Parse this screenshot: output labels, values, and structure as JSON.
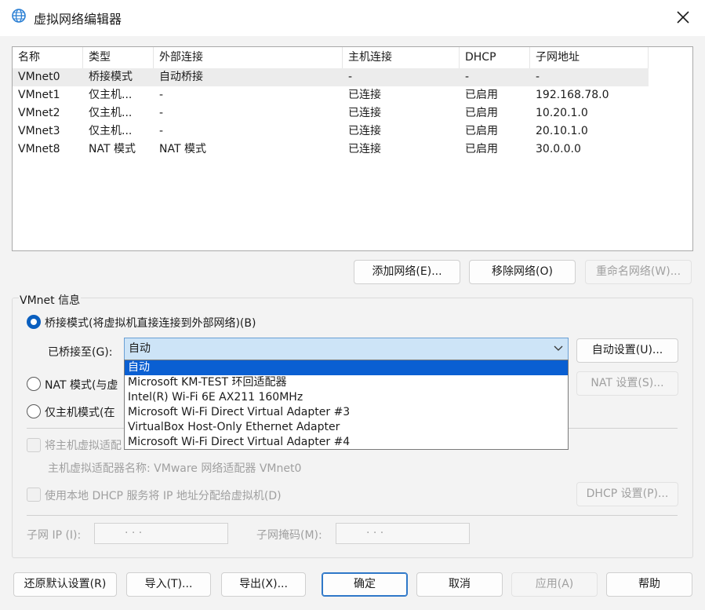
{
  "window": {
    "title": "虚拟网络编辑器",
    "icon": "network-globe-icon",
    "close_icon": "close-icon"
  },
  "table": {
    "headers": [
      "名称",
      "类型",
      "外部连接",
      "主机连接",
      "DHCP",
      "子网地址"
    ],
    "rows": [
      [
        "VMnet0",
        "桥接模式",
        "自动桥接",
        "-",
        "-",
        "-"
      ],
      [
        "VMnet1",
        "仅主机...",
        "-",
        "已连接",
        "已启用",
        "192.168.78.0"
      ],
      [
        "VMnet2",
        "仅主机...",
        "-",
        "已连接",
        "已启用",
        "10.20.1.0"
      ],
      [
        "VMnet3",
        "仅主机...",
        "-",
        "已连接",
        "已启用",
        "20.10.1.0"
      ],
      [
        "VMnet8",
        "NAT 模式",
        "NAT 模式",
        "已连接",
        "已启用",
        "30.0.0.0"
      ]
    ]
  },
  "table_buttons": {
    "add": "添加网络(E)...",
    "remove": "移除网络(O)",
    "rename": "重命名网络(W)..."
  },
  "info": {
    "group_label": "VMnet 信息",
    "bridge_label": "桥接模式(将虚拟机直接连接到外部网络)(B)",
    "bridged_to_label": "已桥接至(G):",
    "bridged_to_value": "自动",
    "auto_settings": "自动设置(U)...",
    "nat_label": "NAT 模式(与虚",
    "nat_settings": "NAT 设置(S)...",
    "hostonly_label": "仅主机模式(在",
    "connect_adapter_label": "将主机虚拟适配",
    "adapter_name_label": "主机虚拟适配器名称: VMware 网络适配器 VMnet0",
    "dhcp_label": "使用本地 DHCP 服务将 IP 地址分配给虚拟机(D)",
    "dhcp_settings": "DHCP 设置(P)...",
    "subnet_ip_label": "子网 IP (I):",
    "subnet_mask_label": "子网掩码(M):",
    "ip_dots": "·       ·       ·"
  },
  "dropdown_options": [
    "自动",
    "Microsoft KM-TEST 环回适配器",
    "Intel(R) Wi-Fi 6E AX211 160MHz",
    "Microsoft Wi-Fi Direct Virtual Adapter #3",
    "VirtualBox Host-Only Ethernet Adapter",
    "Microsoft Wi-Fi Direct Virtual Adapter #4"
  ],
  "footer": {
    "restore": "还原默认设置(R)",
    "import": "导入(T)...",
    "export": "导出(X)...",
    "ok": "确定",
    "cancel": "取消",
    "apply": "应用(A)",
    "help": "帮助"
  },
  "colors": {
    "accent": "#0a5fd2",
    "combo_bg": "#cde4f7",
    "disabled": "#a0a0a0"
  }
}
